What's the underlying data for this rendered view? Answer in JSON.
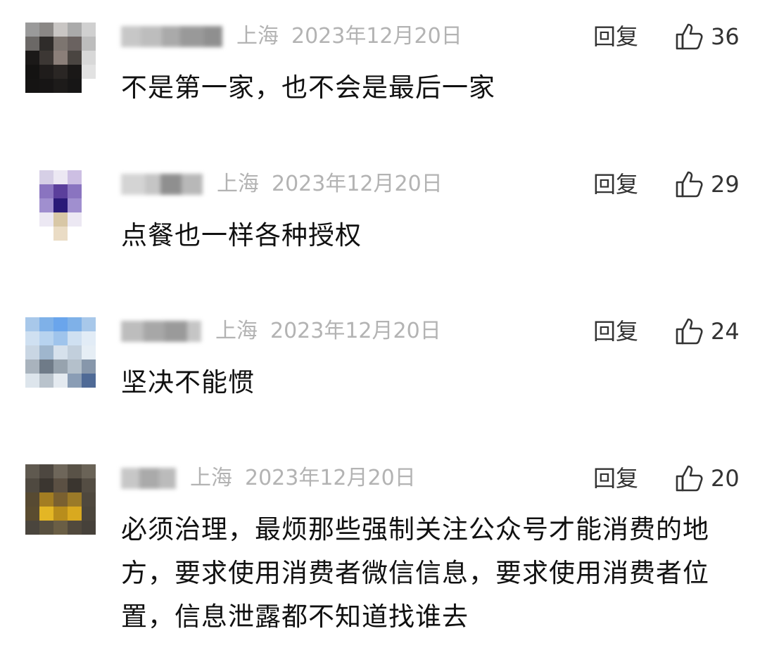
{
  "reply_label": "回复",
  "comments": [
    {
      "location": "上海",
      "date": "2023年12月20日",
      "likes": "36",
      "text": "不是第一家，也不会是最后一家"
    },
    {
      "location": "上海",
      "date": "2023年12月20日",
      "likes": "29",
      "text": "点餐也一样各种授权"
    },
    {
      "location": "上海",
      "date": "2023年12月20日",
      "likes": "24",
      "text": "坚决不能惯"
    },
    {
      "location": "上海",
      "date": "2023年12月20日",
      "likes": "20",
      "text": "必须治理，最烦那些强制关注公众号才能消费的地方，要求使用消费者微信信息，要求使用消费者位置，信息泄露都不知道找谁去"
    }
  ],
  "icons": {
    "like": "thumbs-up-icon"
  },
  "colors": {
    "meta_text": "#b3b3b3",
    "body_text": "#111111",
    "action_text": "#333333"
  }
}
